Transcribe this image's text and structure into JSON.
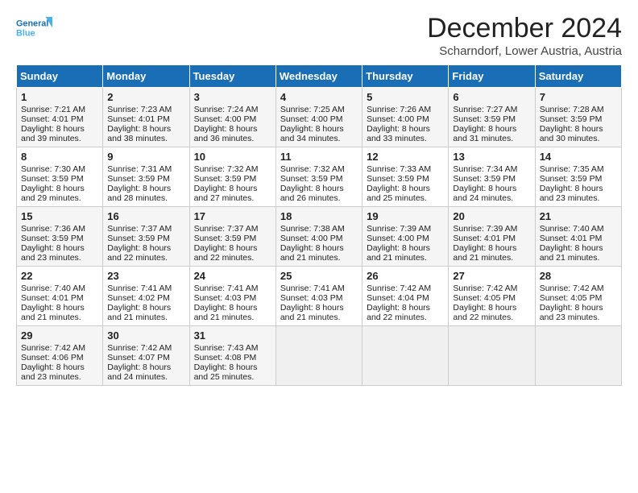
{
  "logo": {
    "line1": "General",
    "line2": "Blue"
  },
  "title": "December 2024",
  "subtitle": "Scharndorf, Lower Austria, Austria",
  "days_of_week": [
    "Sunday",
    "Monday",
    "Tuesday",
    "Wednesday",
    "Thursday",
    "Friday",
    "Saturday"
  ],
  "weeks": [
    [
      {
        "day": "1",
        "sunrise": "7:21 AM",
        "sunset": "4:01 PM",
        "daylight": "8 hours and 39 minutes."
      },
      {
        "day": "2",
        "sunrise": "7:23 AM",
        "sunset": "4:01 PM",
        "daylight": "8 hours and 38 minutes."
      },
      {
        "day": "3",
        "sunrise": "7:24 AM",
        "sunset": "4:00 PM",
        "daylight": "8 hours and 36 minutes."
      },
      {
        "day": "4",
        "sunrise": "7:25 AM",
        "sunset": "4:00 PM",
        "daylight": "8 hours and 34 minutes."
      },
      {
        "day": "5",
        "sunrise": "7:26 AM",
        "sunset": "4:00 PM",
        "daylight": "8 hours and 33 minutes."
      },
      {
        "day": "6",
        "sunrise": "7:27 AM",
        "sunset": "3:59 PM",
        "daylight": "8 hours and 31 minutes."
      },
      {
        "day": "7",
        "sunrise": "7:28 AM",
        "sunset": "3:59 PM",
        "daylight": "8 hours and 30 minutes."
      }
    ],
    [
      {
        "day": "8",
        "sunrise": "7:30 AM",
        "sunset": "3:59 PM",
        "daylight": "8 hours and 29 minutes."
      },
      {
        "day": "9",
        "sunrise": "7:31 AM",
        "sunset": "3:59 PM",
        "daylight": "8 hours and 28 minutes."
      },
      {
        "day": "10",
        "sunrise": "7:32 AM",
        "sunset": "3:59 PM",
        "daylight": "8 hours and 27 minutes."
      },
      {
        "day": "11",
        "sunrise": "7:32 AM",
        "sunset": "3:59 PM",
        "daylight": "8 hours and 26 minutes."
      },
      {
        "day": "12",
        "sunrise": "7:33 AM",
        "sunset": "3:59 PM",
        "daylight": "8 hours and 25 minutes."
      },
      {
        "day": "13",
        "sunrise": "7:34 AM",
        "sunset": "3:59 PM",
        "daylight": "8 hours and 24 minutes."
      },
      {
        "day": "14",
        "sunrise": "7:35 AM",
        "sunset": "3:59 PM",
        "daylight": "8 hours and 23 minutes."
      }
    ],
    [
      {
        "day": "15",
        "sunrise": "7:36 AM",
        "sunset": "3:59 PM",
        "daylight": "8 hours and 23 minutes."
      },
      {
        "day": "16",
        "sunrise": "7:37 AM",
        "sunset": "3:59 PM",
        "daylight": "8 hours and 22 minutes."
      },
      {
        "day": "17",
        "sunrise": "7:37 AM",
        "sunset": "3:59 PM",
        "daylight": "8 hours and 22 minutes."
      },
      {
        "day": "18",
        "sunrise": "7:38 AM",
        "sunset": "4:00 PM",
        "daylight": "8 hours and 21 minutes."
      },
      {
        "day": "19",
        "sunrise": "7:39 AM",
        "sunset": "4:00 PM",
        "daylight": "8 hours and 21 minutes."
      },
      {
        "day": "20",
        "sunrise": "7:39 AM",
        "sunset": "4:01 PM",
        "daylight": "8 hours and 21 minutes."
      },
      {
        "day": "21",
        "sunrise": "7:40 AM",
        "sunset": "4:01 PM",
        "daylight": "8 hours and 21 minutes."
      }
    ],
    [
      {
        "day": "22",
        "sunrise": "7:40 AM",
        "sunset": "4:01 PM",
        "daylight": "8 hours and 21 minutes."
      },
      {
        "day": "23",
        "sunrise": "7:41 AM",
        "sunset": "4:02 PM",
        "daylight": "8 hours and 21 minutes."
      },
      {
        "day": "24",
        "sunrise": "7:41 AM",
        "sunset": "4:03 PM",
        "daylight": "8 hours and 21 minutes."
      },
      {
        "day": "25",
        "sunrise": "7:41 AM",
        "sunset": "4:03 PM",
        "daylight": "8 hours and 21 minutes."
      },
      {
        "day": "26",
        "sunrise": "7:42 AM",
        "sunset": "4:04 PM",
        "daylight": "8 hours and 22 minutes."
      },
      {
        "day": "27",
        "sunrise": "7:42 AM",
        "sunset": "4:05 PM",
        "daylight": "8 hours and 22 minutes."
      },
      {
        "day": "28",
        "sunrise": "7:42 AM",
        "sunset": "4:05 PM",
        "daylight": "8 hours and 23 minutes."
      }
    ],
    [
      {
        "day": "29",
        "sunrise": "7:42 AM",
        "sunset": "4:06 PM",
        "daylight": "8 hours and 23 minutes."
      },
      {
        "day": "30",
        "sunrise": "7:42 AM",
        "sunset": "4:07 PM",
        "daylight": "8 hours and 24 minutes."
      },
      {
        "day": "31",
        "sunrise": "7:43 AM",
        "sunset": "4:08 PM",
        "daylight": "8 hours and 25 minutes."
      },
      null,
      null,
      null,
      null
    ]
  ],
  "labels": {
    "sunrise": "Sunrise:",
    "sunset": "Sunset:",
    "daylight": "Daylight:"
  },
  "colors": {
    "header_bg": "#1a6eb5",
    "header_text": "#ffffff",
    "odd_row_bg": "#f5f5f5",
    "even_row_bg": "#ffffff"
  }
}
